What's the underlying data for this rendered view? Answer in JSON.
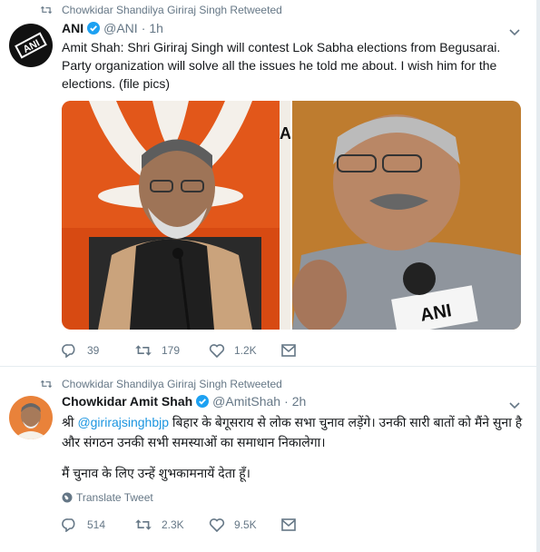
{
  "tweets": [
    {
      "retweet_context": "Chowkidar Shandilya Giriraj Singh Retweeted",
      "author_name": "ANI",
      "author_handle": "@ANI",
      "separator": "·",
      "time": "1h",
      "text": "Amit Shah: Shri Giriraj Singh will contest Lok Sabha elections from Begusarai. Party organization will solve all the issues he told me about. I wish him for the elections. (file pics)",
      "media": [
        {
          "logo_text": "A"
        },
        {
          "mic_label": "ANI"
        }
      ],
      "replies": "39",
      "retweets": "179",
      "likes": "1.2K",
      "avatar_text": "ANI"
    },
    {
      "retweet_context": "Chowkidar Shandilya Giriraj Singh Retweeted",
      "author_name": "Chowkidar Amit Shah",
      "author_handle": "@AmitShah",
      "separator": "·",
      "time": "2h",
      "text_prefix": "श्री ",
      "mention": "@girirajsinghbjp",
      "text_line1_rest": " बिहार के बेगूसराय से लोक सभा चुनाव लड़ेंगे। उनकी सारी बातों को मैंने सुना है और संगठन उनकी सभी समस्याओं का समाधान निकालेगा।",
      "text_line2": "मैं चुनाव के लिए उन्हें शुभकामनायें देता हूँ।",
      "translate_label": "Translate Tweet",
      "replies": "514",
      "retweets": "2.3K",
      "likes": "9.5K"
    }
  ],
  "colors": {
    "secondary_text": "#657786",
    "link": "#1b95e0",
    "verified": "#1da1f2",
    "divider": "#e6ecf0"
  },
  "icons": [
    "retweet-icon",
    "verified-icon",
    "chevron-down-icon",
    "reply-icon",
    "like-icon",
    "message-icon",
    "globe-icon"
  ]
}
